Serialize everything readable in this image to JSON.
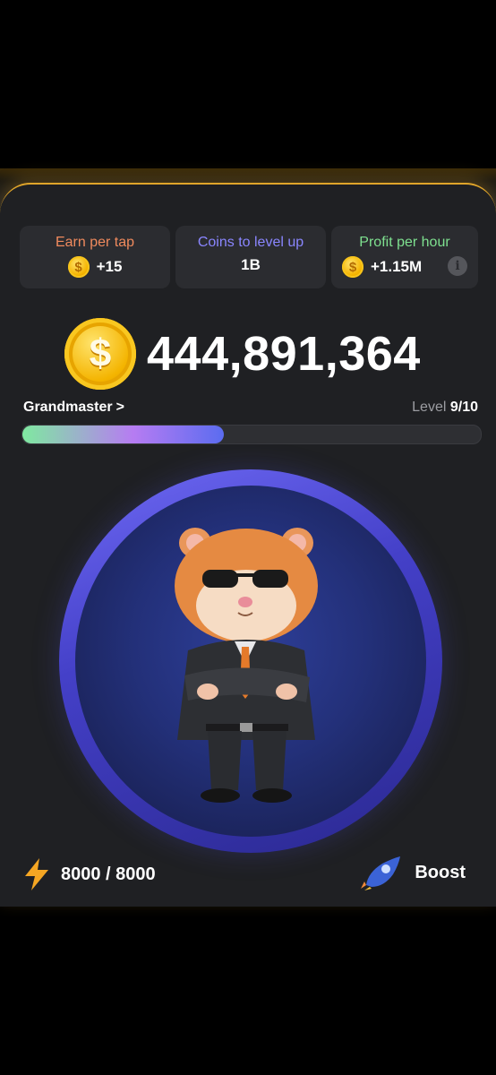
{
  "stats": {
    "earn_per_tap": {
      "title": "Earn per tap",
      "value": "+15",
      "color": "#f08a5d",
      "icon": "coin-icon"
    },
    "coins_to_level": {
      "title": "Coins to level up",
      "value": "1B",
      "color": "#8a86ff"
    },
    "profit_per_hour": {
      "title": "Profit per hour",
      "value": "+1.15M",
      "color": "#7ee08f",
      "icon": "coin-icon",
      "info": "i"
    }
  },
  "balance": {
    "value": "444,891,364",
    "coin_symbol": "$"
  },
  "rank": {
    "label": "Grandmaster",
    "chevron": ">"
  },
  "level": {
    "prefix": "Level",
    "value": "9/10",
    "progress": 0.44
  },
  "energy": {
    "value": "8000 / 8000",
    "icon": "lightning-icon"
  },
  "boost": {
    "label": "Boost",
    "icon": "rocket-icon"
  },
  "colors": {
    "accent_gold": "#e0a52a",
    "panel_bg": "#1f2023",
    "card_bg": "#2b2c30"
  }
}
